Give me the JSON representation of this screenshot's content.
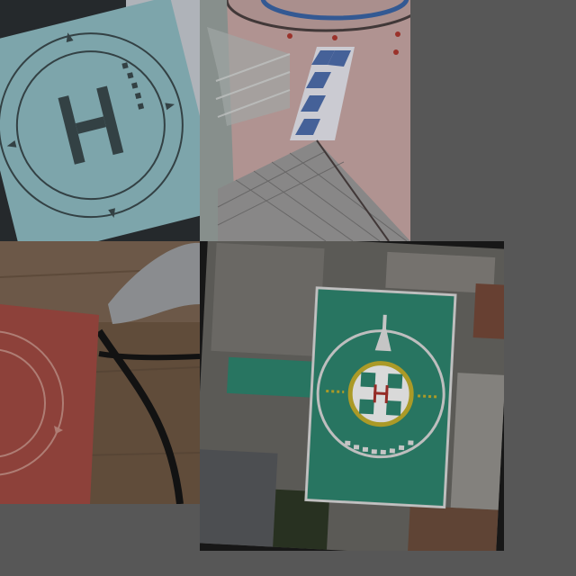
{
  "mosaic": {
    "tiles": [
      {
        "id": "a",
        "subject": "helipad-mat-light-blue",
        "mat_color": "#8fbcc3",
        "marking_color": "#3b4a4e"
      },
      {
        "id": "b",
        "subject": "rooftop-ramp-with-striped-walkway",
        "floor_color": "#c9a8a6",
        "stripe_color": "#4f6fae"
      },
      {
        "id": "c",
        "subject": "helipad-mat-red-folded",
        "mat_color": "#a14a43",
        "marking_color": "#c78f85"
      },
      {
        "id": "d",
        "subject": "aerial-hospital-rooftop-helipad",
        "pad_color": "#2f8a72",
        "cross_color": "#e8e8e8",
        "letter_color": "#b0342e"
      }
    ]
  }
}
